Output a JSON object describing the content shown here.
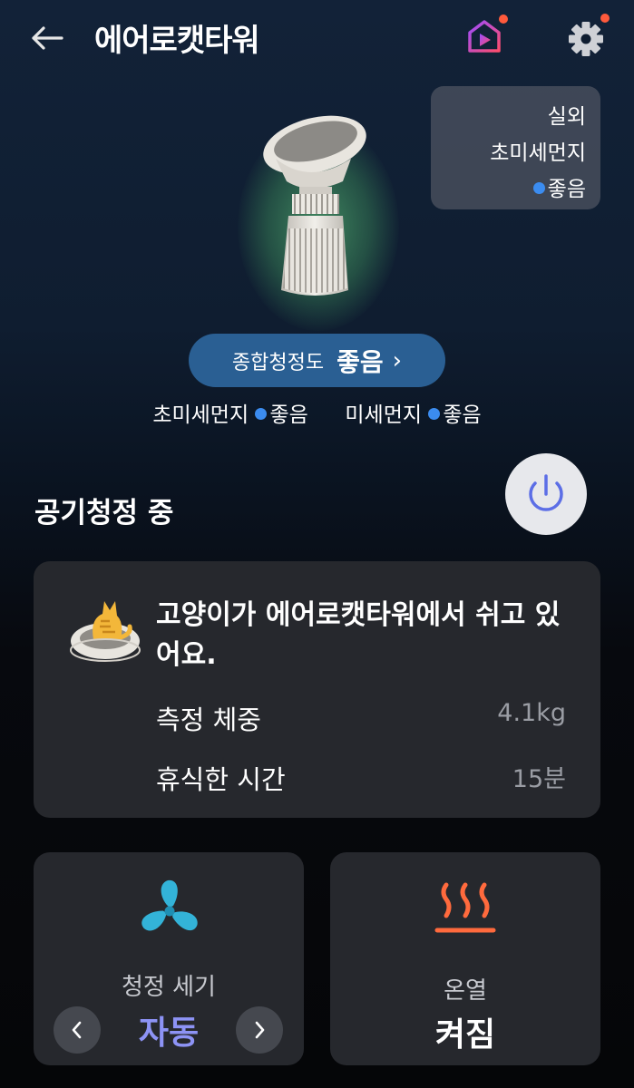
{
  "header": {
    "title": "에어로캣타워",
    "icons": [
      "back-arrow-icon",
      "media-play-icon",
      "gear-icon"
    ]
  },
  "outdoor": {
    "line1": "실외",
    "line2": "초미세먼지",
    "status": "좋음"
  },
  "quality": {
    "label": "종합청정도",
    "value": "좋음",
    "chevron": "›"
  },
  "sub_status": {
    "fine_label": "초미세먼지",
    "fine_value": "좋음",
    "pm10_label": "미세먼지",
    "pm10_value": "좋음"
  },
  "status": {
    "label": "공기청정 중"
  },
  "cat": {
    "message": "고양이가 에어로캣타워에서 쉬고 있어요.",
    "weight_label": "측정 체중",
    "weight_value": "4.1kg",
    "rest_label": "휴식한 시간",
    "rest_value": "15분"
  },
  "fan": {
    "label": "청정 세기",
    "value": "자동",
    "prev": "‹",
    "next": "›"
  },
  "heat": {
    "label": "온열",
    "value": "켜짐"
  },
  "colors": {
    "accent": "#8d93f5",
    "good_dot": "#3b8cf0",
    "pill": "#2a5f93",
    "card": "#26282d",
    "heat": "#ff6a3d",
    "fan": "#33b3d8"
  }
}
